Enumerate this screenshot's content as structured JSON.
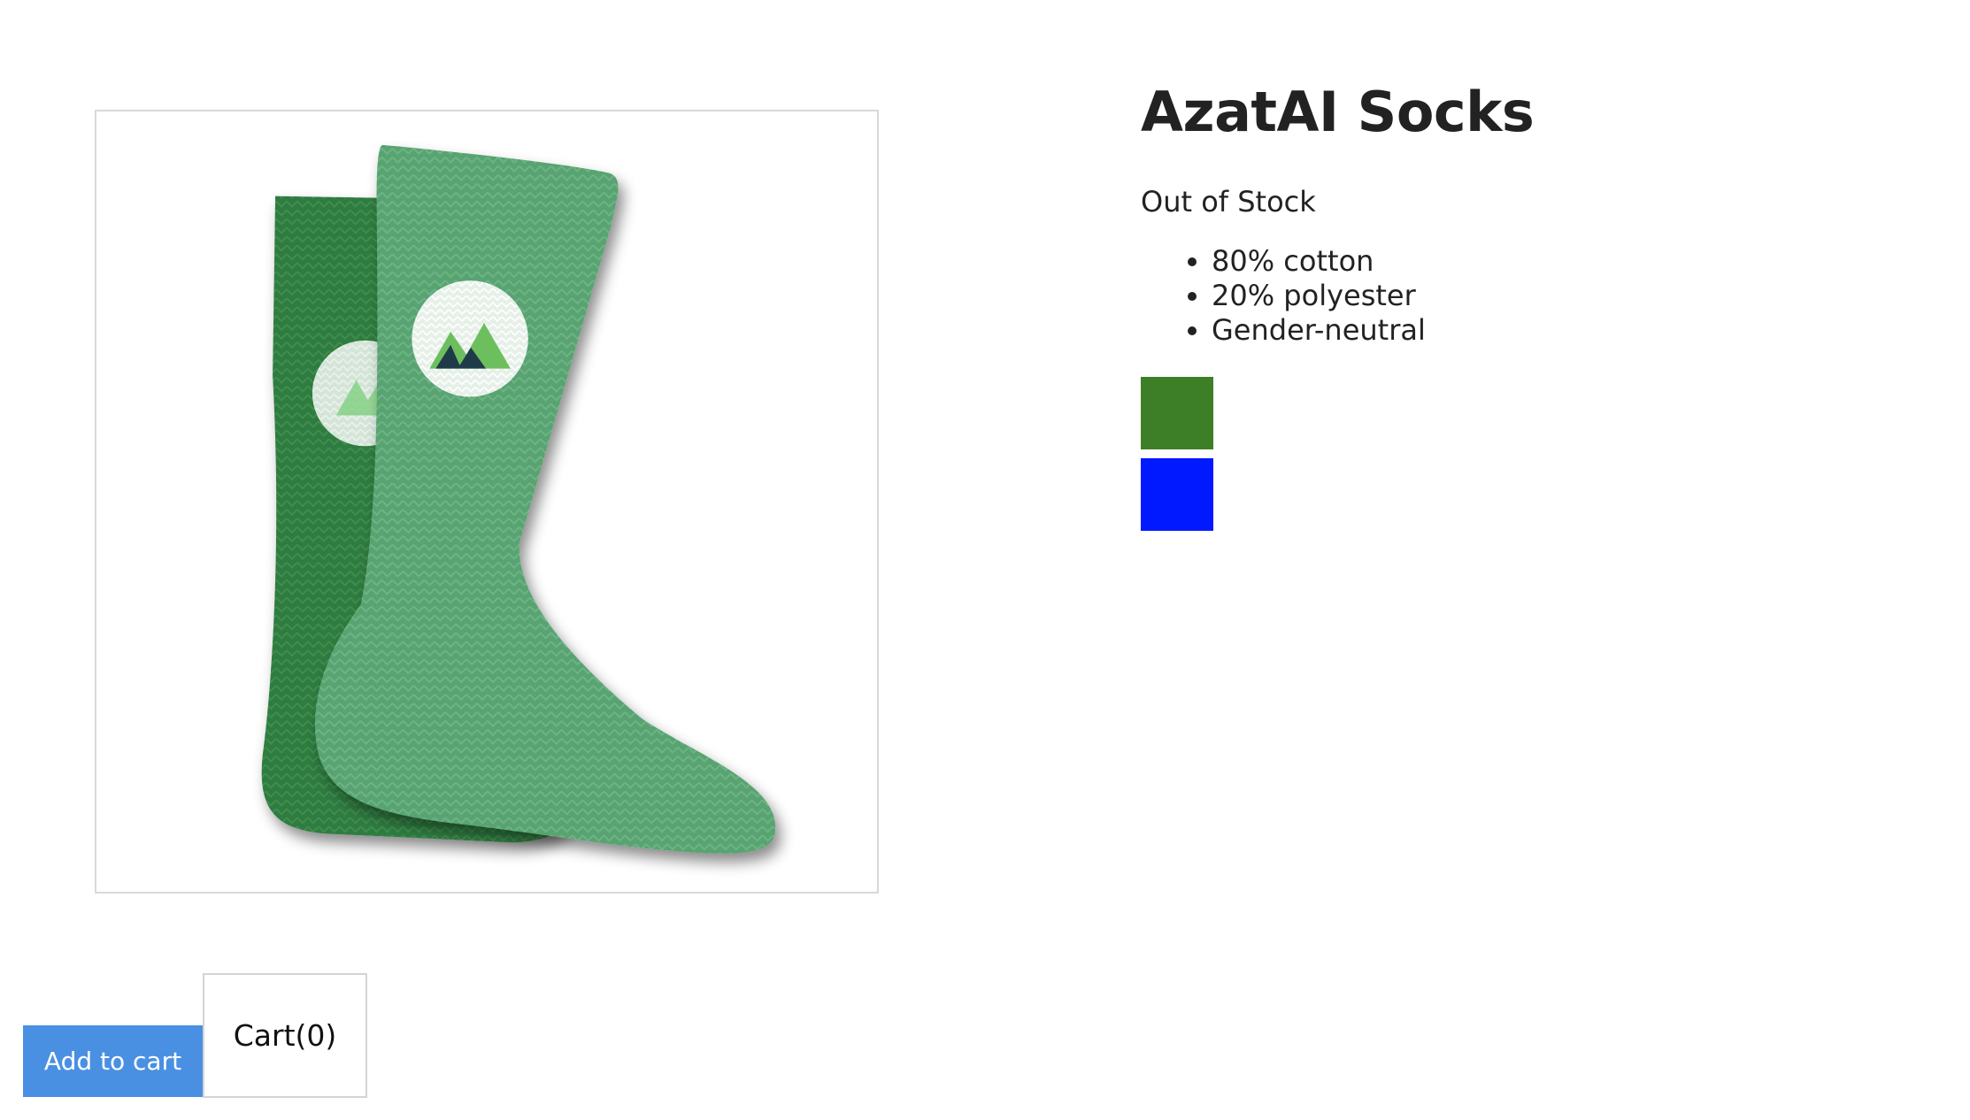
{
  "product": {
    "title": "AzatAI Socks",
    "stock_status": "Out of Stock",
    "features": [
      "80% cotton",
      "20% polyester",
      "Gender-neutral"
    ],
    "image_icon": "sock-product-image"
  },
  "variants": [
    {
      "name": "green",
      "color": "#3d7f27"
    },
    {
      "name": "blue",
      "color": "#0019ff"
    }
  ],
  "actions": {
    "add_to_cart_label": "Add to cart",
    "cart_label": "Cart(0)"
  },
  "colors": {
    "accent": "#4a90e2",
    "sock_back": "#2e7a3e",
    "sock_front": "#5aa574"
  }
}
